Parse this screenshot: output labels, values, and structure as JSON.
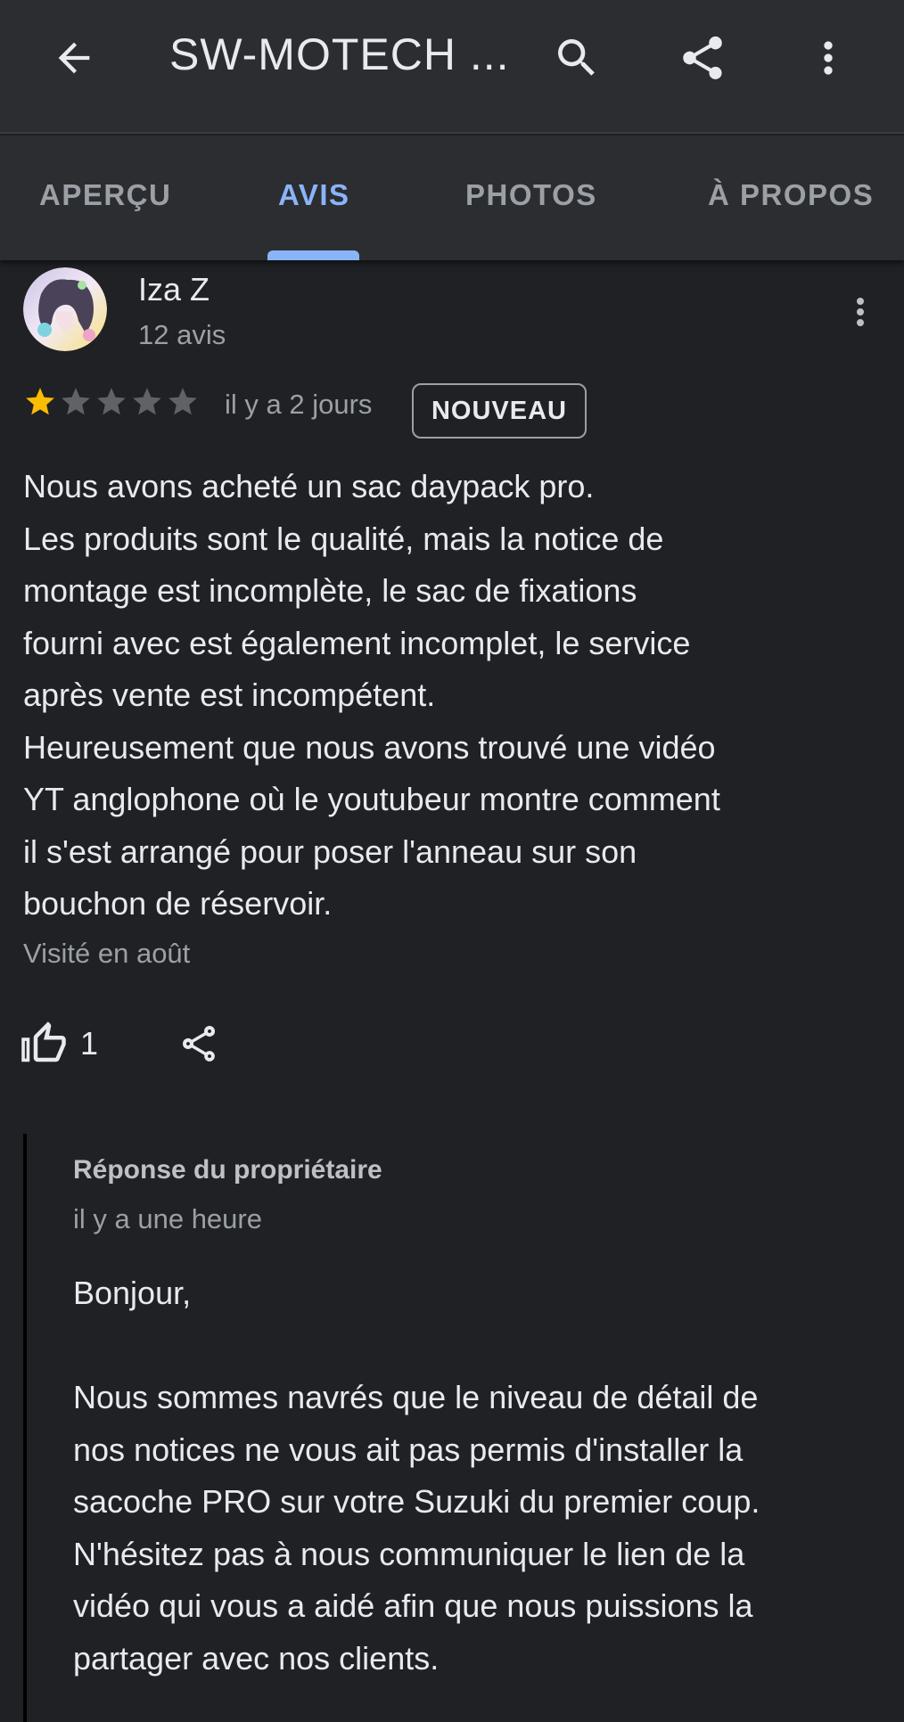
{
  "appbar": {
    "title": "SW-MOTECH ...",
    "icons": [
      "back-arrow-icon",
      "search-icon",
      "share-icon",
      "more-vert-icon"
    ]
  },
  "tabs": [
    {
      "label": "APERÇU",
      "active": false
    },
    {
      "label": "AVIS",
      "active": true
    },
    {
      "label": "PHOTOS",
      "active": false
    },
    {
      "label": "À PROPOS",
      "active": false
    }
  ],
  "review": {
    "reviewer_name": "Iza Z",
    "reviewer_review_count": "12 avis",
    "rating": 1,
    "rating_max": 5,
    "date": "il y a 2 jours",
    "badge": "NOUVEAU",
    "text": "Nous avons acheté un sac daypack pro.\nLes produits sont le qualité, mais la notice de\nmontage est incomplète, le sac de fixations\nfourni avec est également incomplet, le service\naprès vente est incompétent.\nHeureusement que nous avons trouvé une vidéo\nYT anglophone où le youtubeur montre comment\nil s'est arrangé pour poser l'anneau sur son\nbouchon de réservoir.",
    "visited": "Visité en août",
    "like_count": "1"
  },
  "owner_reply": {
    "label": "Réponse du propriétaire",
    "date": "il y a une heure",
    "text": "Bonjour,\n\nNous sommes navrés que le niveau de détail de\nnos notices ne vous ait pas permis d'installer la\nsacoche PRO sur votre Suzuki du premier coup.\nN'hésitez pas à nous communiquer le lien de la\nvidéo qui vous a aidé afin que nous puissions la\npartager avec nos clients."
  },
  "colors": {
    "background": "#202124",
    "appbar": "#2c2d31",
    "accent": "#8ab4f8",
    "star_filled": "#fbbc04",
    "star_empty": "#5f6368",
    "text_primary": "#e8eaed",
    "text_secondary": "#9aa0a6"
  }
}
